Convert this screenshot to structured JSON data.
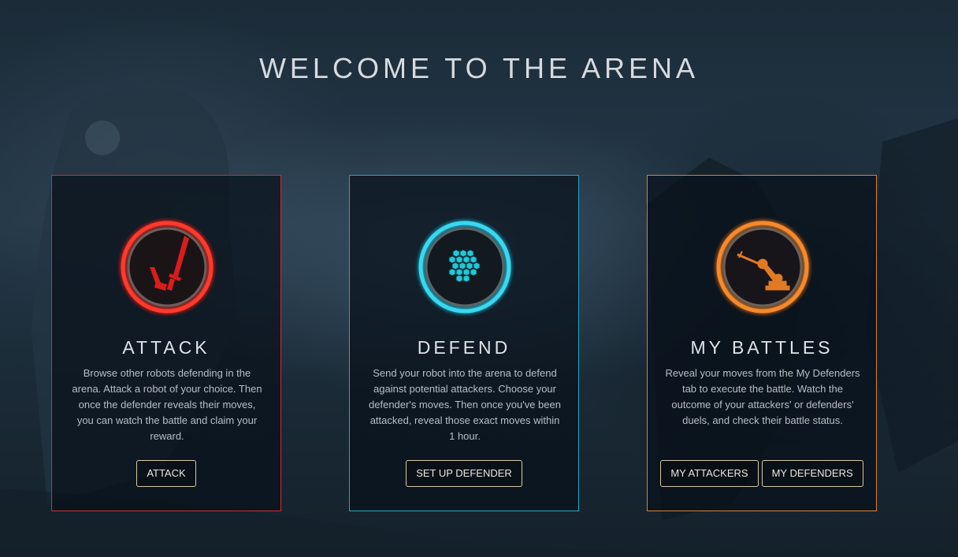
{
  "page": {
    "title": "WELCOME TO THE ARENA"
  },
  "colors": {
    "attack": "#c8303a",
    "defend": "#2aa6c0",
    "battles": "#d8823a",
    "button_border": "#d5c9a6"
  },
  "cards": [
    {
      "id": "attack",
      "icon": "sword-icon",
      "title": "ATTACK",
      "description": "Browse other robots defending in the arena. Attack a robot of your choice. Then once the defender reveals their moves, you can watch the battle and claim your reward.",
      "buttons": [
        "ATTACK"
      ]
    },
    {
      "id": "defend",
      "icon": "hex-shield-icon",
      "title": "DEFEND",
      "description": "Send your robot into the arena to defend against potential attackers. Choose your defender's moves. Then once you've been attacked, reveal those exact moves within 1 hour.",
      "buttons": [
        "SET UP DEFENDER"
      ]
    },
    {
      "id": "battles",
      "icon": "robot-arm-icon",
      "title": "MY BATTLES",
      "description": "Reveal your moves from the My Defenders tab to execute the battle. Watch the outcome of your attackers' or defenders' duels, and check their battle status.",
      "buttons": [
        "MY ATTACKERS",
        "MY DEFENDERS"
      ]
    }
  ]
}
